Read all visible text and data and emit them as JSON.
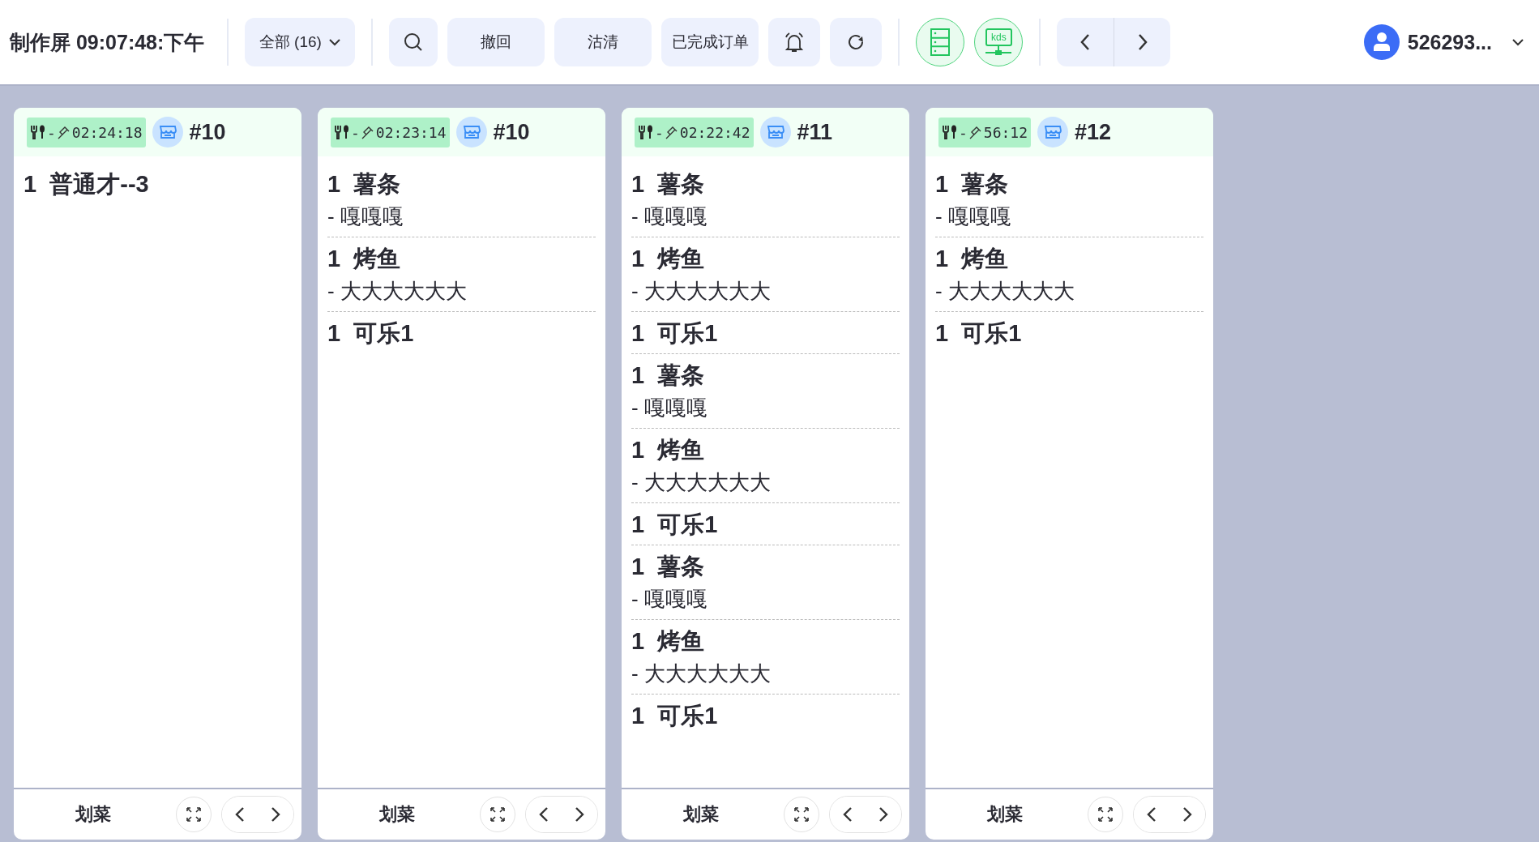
{
  "header": {
    "title": "制作屏 09:07:48:下午",
    "filter": {
      "label": "全部 (16)"
    },
    "buttons": [
      {
        "kind": "search"
      },
      {
        "kind": "text",
        "label": "撤回"
      },
      {
        "kind": "text",
        "label": "沽清"
      },
      {
        "kind": "text",
        "label": "已完成订单"
      },
      {
        "kind": "bell"
      },
      {
        "kind": "refresh"
      }
    ],
    "mode_buttons": [
      {
        "kind": "list"
      },
      {
        "kind": "kds",
        "label": "kds"
      }
    ],
    "user": {
      "name": "526293..."
    }
  },
  "cards": [
    {
      "dash": "-",
      "timer": "02:24:18",
      "order": "#10",
      "items": [
        {
          "qty": "1",
          "name": "普通才--3"
        }
      ],
      "footer": {
        "action": "划菜"
      }
    },
    {
      "dash": "-",
      "timer": "02:23:14",
      "order": "#10",
      "items": [
        {
          "qty": "1",
          "name": "薯条",
          "modifiers": [
            "- 嘎嘎嘎"
          ]
        },
        {
          "qty": "1",
          "name": "烤鱼",
          "modifiers": [
            "- 大大大大大大"
          ]
        },
        {
          "qty": "1",
          "name": "可乐1"
        }
      ],
      "footer": {
        "action": "划菜"
      }
    },
    {
      "dash": "-",
      "timer": "02:22:42",
      "order": "#11",
      "items": [
        {
          "qty": "1",
          "name": "薯条",
          "modifiers": [
            "- 嘎嘎嘎"
          ]
        },
        {
          "qty": "1",
          "name": "烤鱼",
          "modifiers": [
            "- 大大大大大大"
          ]
        },
        {
          "qty": "1",
          "name": "可乐1"
        },
        {
          "qty": "1",
          "name": "薯条",
          "modifiers": [
            "- 嘎嘎嘎"
          ]
        },
        {
          "qty": "1",
          "name": "烤鱼",
          "modifiers": [
            "- 大大大大大大"
          ]
        },
        {
          "qty": "1",
          "name": "可乐1"
        },
        {
          "qty": "1",
          "name": "薯条",
          "modifiers": [
            "- 嘎嘎嘎"
          ]
        },
        {
          "qty": "1",
          "name": "烤鱼",
          "modifiers": [
            "- 大大大大大大"
          ]
        },
        {
          "qty": "1",
          "name": "可乐1"
        }
      ],
      "footer": {
        "action": "划菜"
      }
    },
    {
      "dash": "-",
      "timer": "56:12",
      "order": "#12",
      "items": [
        {
          "qty": "1",
          "name": "薯条",
          "modifiers": [
            "- 嘎嘎嘎"
          ]
        },
        {
          "qty": "1",
          "name": "烤鱼",
          "modifiers": [
            "- 大大大大大大"
          ]
        },
        {
          "qty": "1",
          "name": "可乐1"
        }
      ],
      "footer": {
        "action": "划菜"
      }
    }
  ]
}
